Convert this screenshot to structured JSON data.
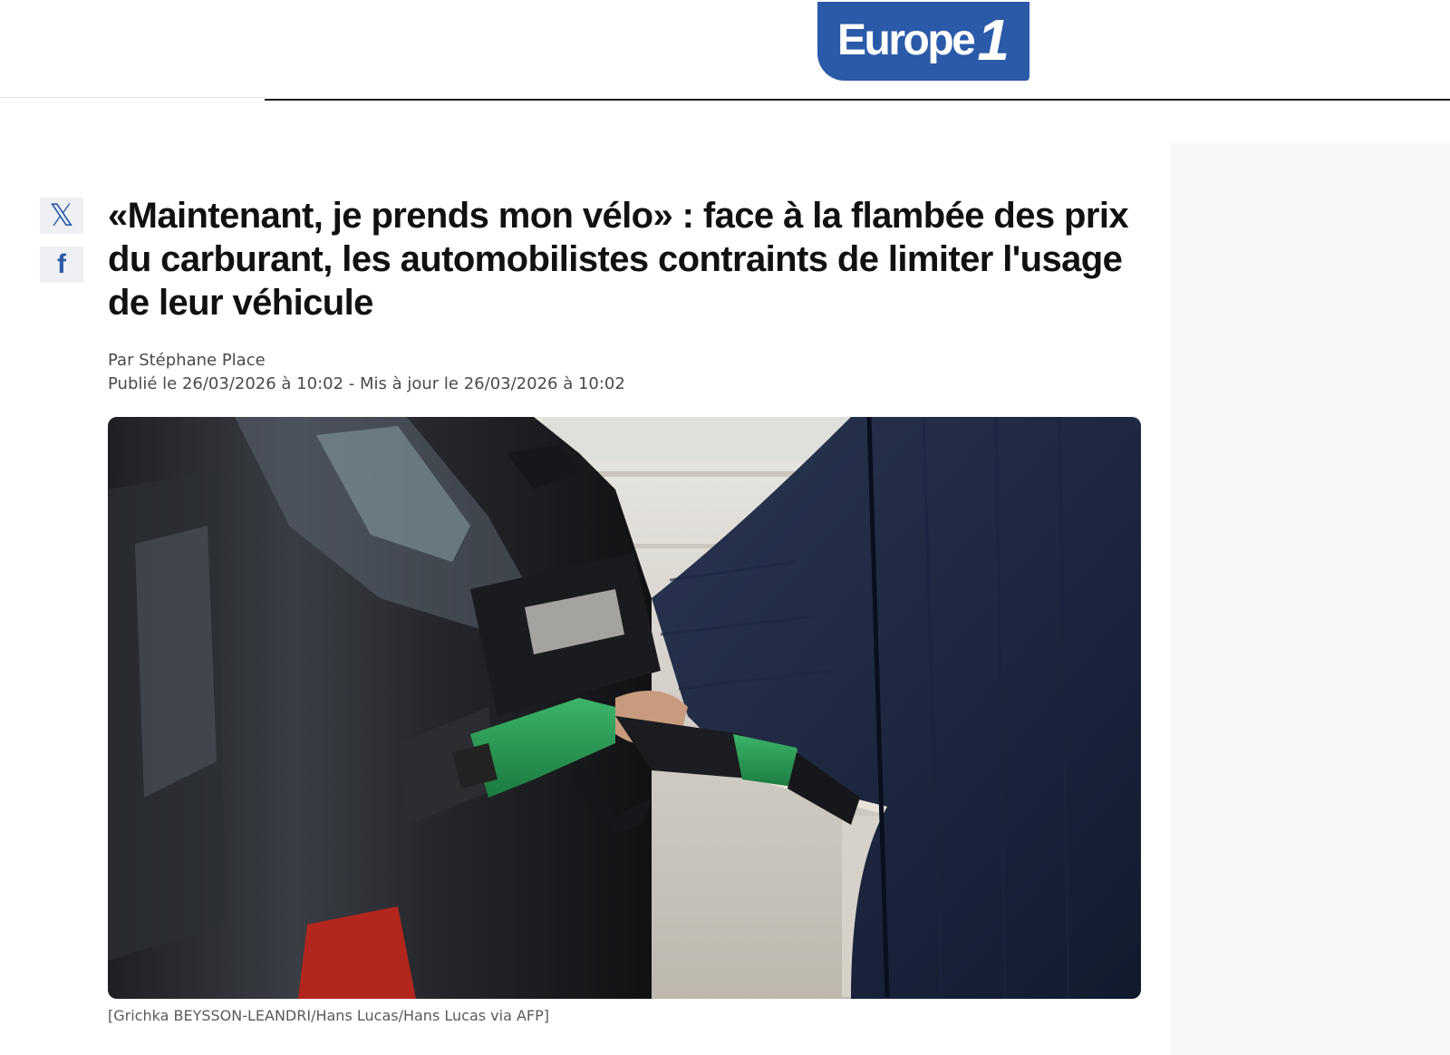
{
  "header": {
    "logo": {
      "wordmark": "Europe",
      "numeral": "1",
      "brand_color": "#2a5aa8"
    }
  },
  "share": {
    "x_icon": "x-twitter-icon",
    "facebook_icon": "facebook-icon"
  },
  "article": {
    "headline": "«Maintenant, je prends mon vélo» : face à la flambée des prix du carburant, les automobilistes contraints de limiter l'usage de leur véhicule",
    "byline": "Par Stéphane Place",
    "dates": "Publié le 26/03/2026 à 10:02 - Mis à jour le 26/03/2026 à 10:02",
    "image": {
      "credit": "[Grichka BEYSSON-LEANDRI/Hans Lucas/Hans Lucas via AFP]"
    }
  }
}
